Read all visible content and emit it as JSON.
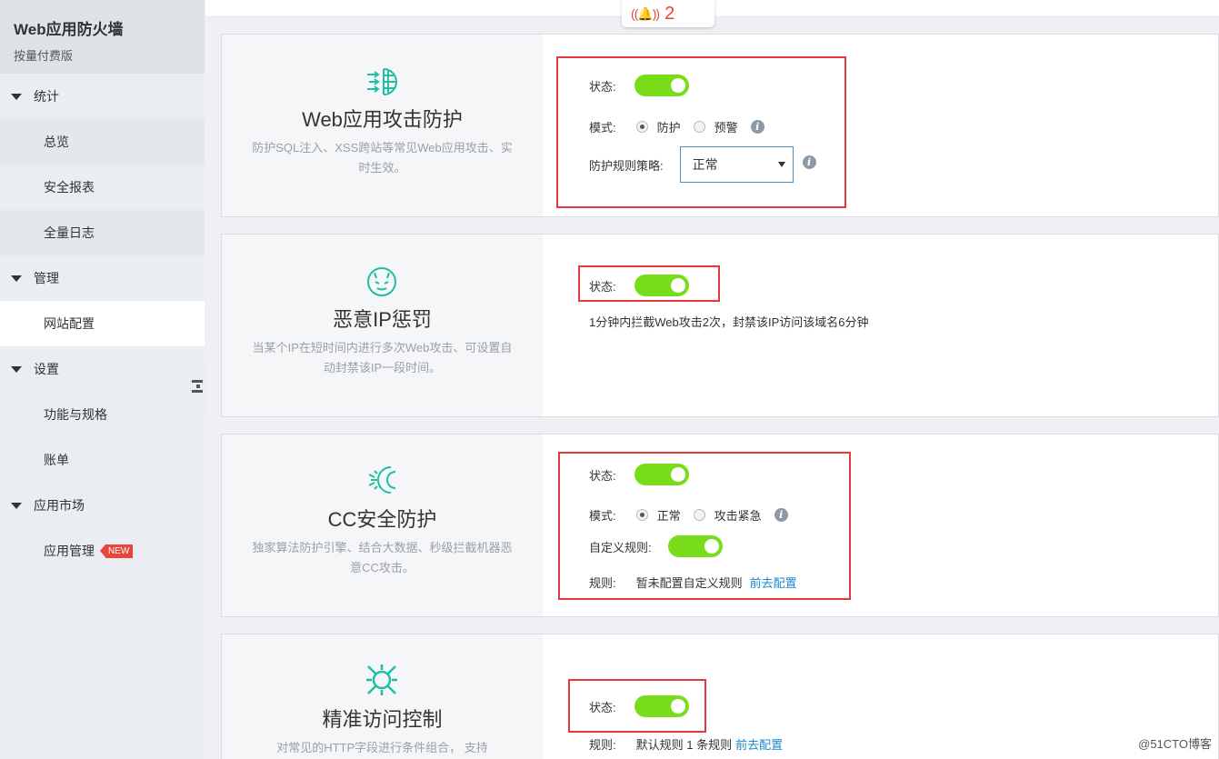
{
  "sidebar": {
    "title": "Web应用防火墙",
    "subtitle": "按量付费版",
    "groups": [
      {
        "label": "统计",
        "items": [
          "总览",
          "安全报表",
          "全量日志"
        ]
      },
      {
        "label": "管理",
        "items": [
          "网站配置"
        ]
      },
      {
        "label": "设置",
        "items": [
          "功能与规格",
          "账单"
        ]
      },
      {
        "label": "应用市场",
        "items": [
          "应用管理"
        ]
      }
    ],
    "new_badge": "NEW"
  },
  "alarm": {
    "icon": "bell-alarm-icon",
    "count": "2",
    "color": "#e9443a"
  },
  "colors": {
    "toggle_on": "#79dd1b",
    "link": "#1e88d0",
    "highlight_box": "#e5393b"
  },
  "cards": [
    {
      "icon": "shield-arrows-icon",
      "title": "Web应用攻击防护",
      "desc": "防护SQL注入、XSS跨站等常见Web应用攻击、实时生效。",
      "status_label": "状态:",
      "mode_label": "模式:",
      "mode_options": [
        "防护",
        "预警"
      ],
      "mode_selected": "防护",
      "policy_label": "防护规则策略:",
      "policy_value": "正常"
    },
    {
      "icon": "devil-face-icon",
      "title": "恶意IP惩罚",
      "desc": "当某个IP在短时间内进行多次Web攻击、可设置自动封禁该IP一段时间。",
      "status_label": "状态:",
      "note": "1分钟内拦截Web攻击2次，封禁该IP访问该域名6分钟"
    },
    {
      "icon": "cc-shield-icon",
      "title": "CC安全防护",
      "desc": "独家算法防护引擎、结合大数据、秒级拦截机器恶意CC攻击。",
      "status_label": "状态:",
      "mode_label": "模式:",
      "mode_options": [
        "正常",
        "攻击紧急"
      ],
      "mode_selected": "正常",
      "custom_rule_label": "自定义规则:",
      "rule_label": "规则:",
      "rule_text": "暂未配置自定义规则",
      "rule_link": "前去配置"
    },
    {
      "icon": "precise-target-icon",
      "title": "精准访问控制",
      "desc": "对常见的HTTP字段进行条件组合， 支持",
      "status_label": "状态:",
      "rule_label": "规则:",
      "rule_text": "默认规则 1 条规则",
      "rule_link": "前去配置"
    }
  ],
  "watermark": "@51CTO博客"
}
